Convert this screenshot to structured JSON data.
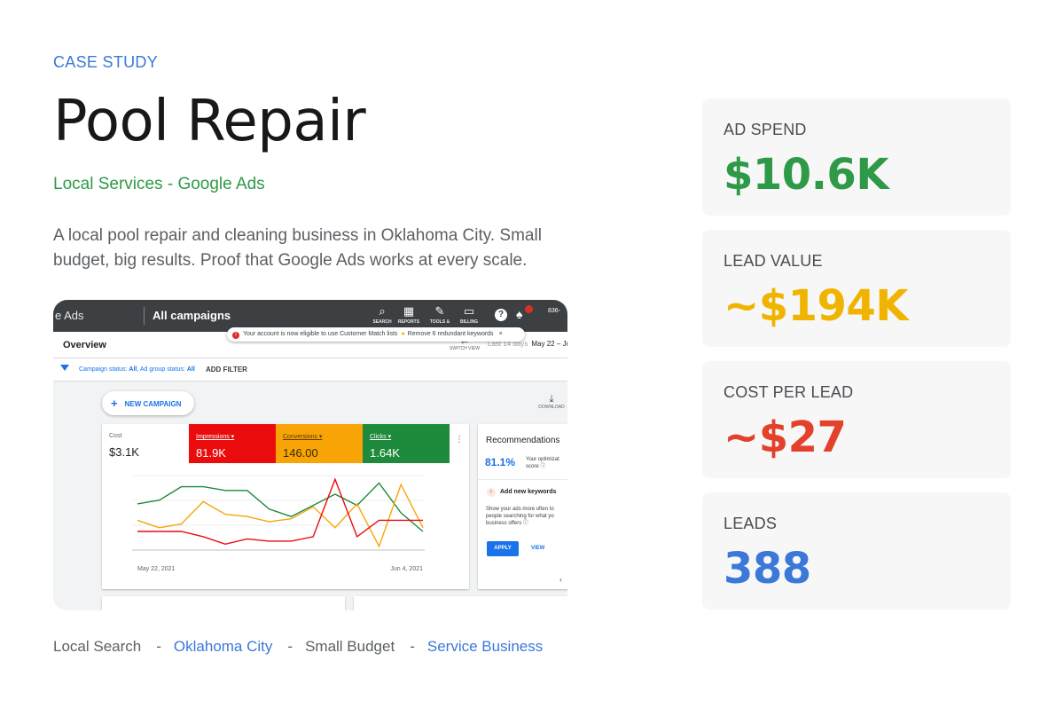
{
  "header": {
    "eyebrow": "CASE STUDY",
    "title": "Pool Repair",
    "subtitle": "Local Services - Google Ads",
    "description": "A local pool repair and cleaning business in Oklahoma City. Small budget, big results. Proof that Google Ads works at every scale."
  },
  "ads_screenshot": {
    "brand": "e Ads",
    "section": "All campaigns",
    "toolbar": [
      {
        "icon": "search-icon",
        "label": "SEARCH"
      },
      {
        "icon": "reports-icon",
        "label": "REPORTS"
      },
      {
        "icon": "tools-icon",
        "label": "TOOLS &"
      },
      {
        "icon": "billing-icon",
        "label": "BILLING"
      }
    ],
    "account": "836-",
    "notification": {
      "message": "Your account is now eligible to use Customer Match lists",
      "tip": "Remove 6 redundant keywords"
    },
    "overview": "Overview",
    "switch_view": "SWITCH VIEW",
    "date_hint": "Last 14 days",
    "date_range": "May 22 – Jun",
    "filter_prefix": "Campaign status: ",
    "filter_status": "All",
    "filter_mid": ", Ad group status: ",
    "filter_group": "All",
    "add_filter": "ADD FILTER",
    "new_campaign": "NEW CAMPAIGN",
    "download": "DOWNLOAD",
    "metrics": [
      {
        "label": "Cost",
        "value": "$3.1K",
        "color": "#ffffff"
      },
      {
        "label": "Impressions ▾",
        "value": "81.9K",
        "color": "#ea0c0c"
      },
      {
        "label": "Conversions ▾",
        "value": "146.00",
        "color": "#f8a407"
      },
      {
        "label": "Clicks ▾",
        "value": "1.64K",
        "color": "#1e8a3c"
      }
    ],
    "chart_start": "May 22, 2021",
    "chart_end": "Jun 4, 2021",
    "recommendations": {
      "title": "Recommendations",
      "score": "81.1%",
      "score_label_1": "Your optimizat",
      "score_label_2": "score ⓘ",
      "item": "Add new keywords",
      "desc_1": "Show your ads more often to",
      "desc_2": "people searching for what yo",
      "desc_3": "business offers ⓘ",
      "apply": "APPLY",
      "view": "VIEW"
    }
  },
  "chart_data": {
    "type": "line",
    "x": [
      1,
      2,
      3,
      4,
      5,
      6,
      7,
      8,
      9,
      10,
      11,
      12,
      13,
      14
    ],
    "xlabel_start": "May 22, 2021",
    "xlabel_end": "Jun 4, 2021",
    "series": [
      {
        "color": "#1e8a3c",
        "values": [
          0.62,
          0.67,
          0.85,
          0.85,
          0.8,
          0.8,
          0.55,
          0.45,
          0.6,
          0.75,
          0.6,
          0.9,
          0.5,
          0.25
        ]
      },
      {
        "color": "#f8a407",
        "values": [
          0.4,
          0.3,
          0.35,
          0.65,
          0.48,
          0.45,
          0.38,
          0.42,
          0.58,
          0.3,
          0.62,
          0.05,
          0.88,
          0.3
        ]
      },
      {
        "color": "#ea0c0c",
        "values": [
          0.25,
          0.25,
          0.25,
          0.18,
          0.08,
          0.15,
          0.12,
          0.12,
          0.18,
          0.95,
          0.18,
          0.4,
          0.4,
          0.4
        ]
      }
    ]
  },
  "tags": [
    "Local Search",
    "Oklahoma City",
    "Small Budget",
    "Service Business"
  ],
  "tag_separator": "-",
  "stats": [
    {
      "label": "AD SPEND",
      "value": "$10.6K",
      "color": "#2e9a48"
    },
    {
      "label": "LEAD VALUE",
      "value": "~$194K",
      "color": "#f0b400"
    },
    {
      "label": "COST PER LEAD",
      "value": "~$27",
      "color": "#e3412b"
    },
    {
      "label": "LEADS",
      "value": "388",
      "color": "#3b78d8"
    }
  ]
}
